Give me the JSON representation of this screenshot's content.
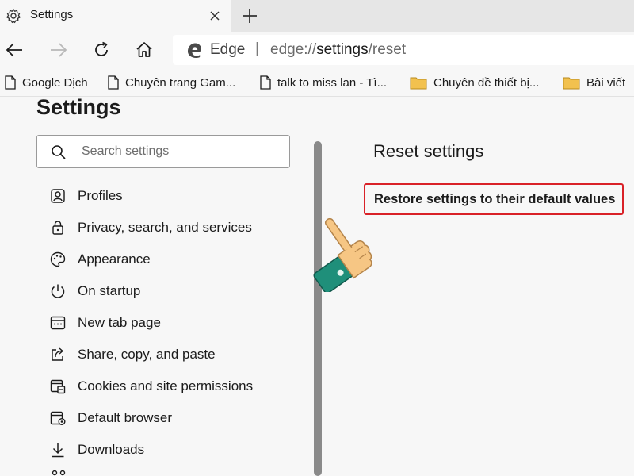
{
  "tab": {
    "title": "Settings",
    "icon": "gear-icon"
  },
  "toolbar": {
    "back": "back-arrow-icon",
    "forward": "forward-arrow-icon",
    "refresh": "refresh-icon",
    "home": "home-icon"
  },
  "address": {
    "brand": "Edge",
    "separator": "|",
    "url_scheme": "edge://",
    "url_strong": "settings",
    "url_path": "/reset"
  },
  "bookmarks": [
    {
      "label": "Google Dịch",
      "icon": "page-icon"
    },
    {
      "label": "Chuyên trang Gam...",
      "icon": "page-icon"
    },
    {
      "label": "talk to miss lan - Tì...",
      "icon": "page-icon"
    },
    {
      "label": "Chuyên đề thiết bị...",
      "icon": "folder-icon"
    },
    {
      "label": "Bài viết",
      "icon": "folder-icon"
    }
  ],
  "sidebar": {
    "title": "Settings",
    "search_placeholder": "Search settings",
    "items": [
      {
        "label": "Profiles",
        "icon": "profile-icon"
      },
      {
        "label": "Privacy, search, and services",
        "icon": "lock-icon"
      },
      {
        "label": "Appearance",
        "icon": "palette-icon"
      },
      {
        "label": "On startup",
        "icon": "power-icon"
      },
      {
        "label": "New tab page",
        "icon": "new-tab-icon"
      },
      {
        "label": "Share, copy, and paste",
        "icon": "share-icon"
      },
      {
        "label": "Cookies and site permissions",
        "icon": "cookies-icon"
      },
      {
        "label": "Default browser",
        "icon": "browser-icon"
      },
      {
        "label": "Downloads",
        "icon": "download-icon"
      }
    ]
  },
  "main": {
    "section_title": "Reset settings",
    "restore_button": "Restore settings to their default values"
  },
  "colors": {
    "highlight_border": "#d92128",
    "folder": "#f2c14e",
    "pointer_skin": "#f6c684",
    "pointer_cuff": "#1f8f7a"
  }
}
